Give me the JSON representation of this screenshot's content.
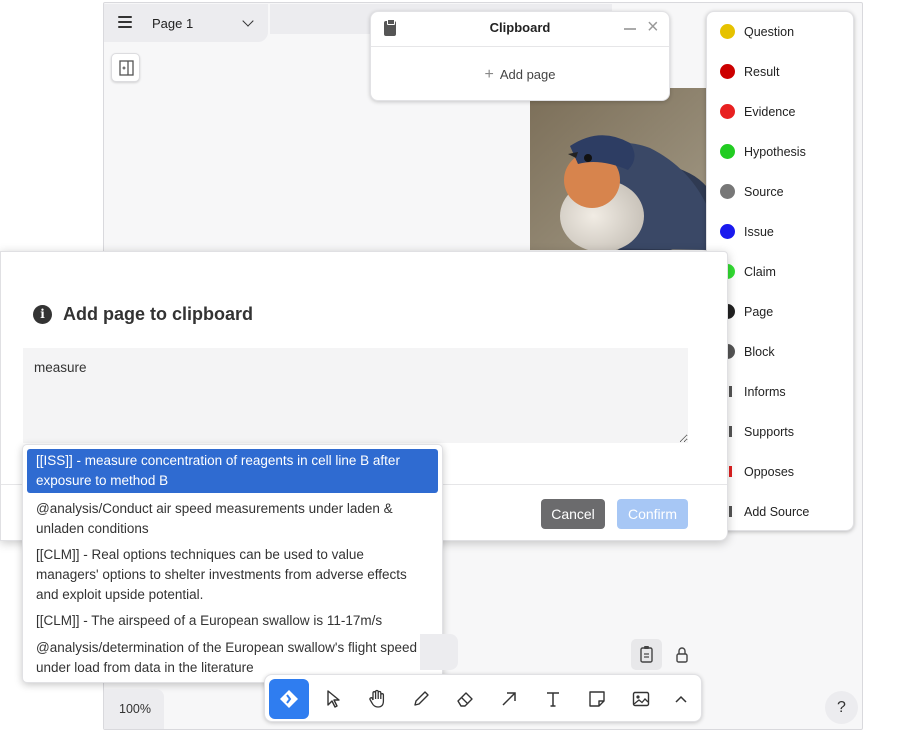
{
  "page_menu": {
    "current_page": "Page 1"
  },
  "clipboard": {
    "title": "Clipboard",
    "add_page_label": "Add page"
  },
  "types_menu": {
    "items": [
      {
        "label": "Question",
        "color": "#e6c200"
      },
      {
        "label": "Result",
        "color": "#cc0000"
      },
      {
        "label": "Evidence",
        "color": "#e82020"
      },
      {
        "label": "Hypothesis",
        "color": "#22cc22"
      },
      {
        "label": "Source",
        "color": "#777777"
      },
      {
        "label": "Issue",
        "color": "#1a1aee"
      },
      {
        "label": "Claim",
        "color": "#33dd33"
      },
      {
        "label": "Page",
        "color": "#222222"
      },
      {
        "label": "Block",
        "color": "#555555"
      },
      {
        "label": "Informs",
        "color": ""
      },
      {
        "label": "Supports",
        "color": ""
      },
      {
        "label": "Opposes",
        "color": "#e02020"
      },
      {
        "label": "Add Source",
        "color": ""
      }
    ]
  },
  "dialog": {
    "title": "Add page to clipboard",
    "input_value": "measure",
    "cancel_label": "Cancel",
    "confirm_label": "Confirm"
  },
  "suggestions": [
    {
      "text": "[[ISS]] - measure concentration of reagents in cell line B after exposure to method B",
      "selected": true
    },
    {
      "text": "@analysis/Conduct air speed measurements under laden & unladen conditions",
      "selected": false
    },
    {
      "text": "[[CLM]] - Real options techniques can be used to value managers' options to shelter investments from adverse effects and exploit upside potential.",
      "selected": false
    },
    {
      "text": "[[CLM]] - The airspeed of a European swallow is 11-17m/s",
      "selected": false
    },
    {
      "text": "@analysis/determination of the European swallow's flight speed under load from data in the literature",
      "selected": false
    }
  ],
  "toolbar": {
    "tools": [
      "discourse-graph-tool",
      "select-tool",
      "hand-tool",
      "draw-tool",
      "eraser-tool",
      "arrow-tool",
      "text-tool",
      "note-tool",
      "media-tool",
      "more-tools"
    ],
    "active_tool": "discourse-graph-tool"
  },
  "zoom_label": "100%",
  "help_label": "?",
  "accent_color": "#2f6bd1"
}
